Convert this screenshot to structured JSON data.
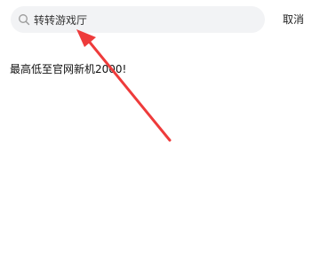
{
  "search": {
    "value": "转转游戏厅",
    "cancel_label": "取消"
  },
  "results": [
    {
      "label": "最高低至官网新机2000!"
    }
  ],
  "colors": {
    "search_bg": "#f2f3f5",
    "arrow": "#ee3b3b",
    "text": "#222222"
  },
  "icons": {
    "search": "search-icon",
    "annotation": "red-arrow"
  }
}
